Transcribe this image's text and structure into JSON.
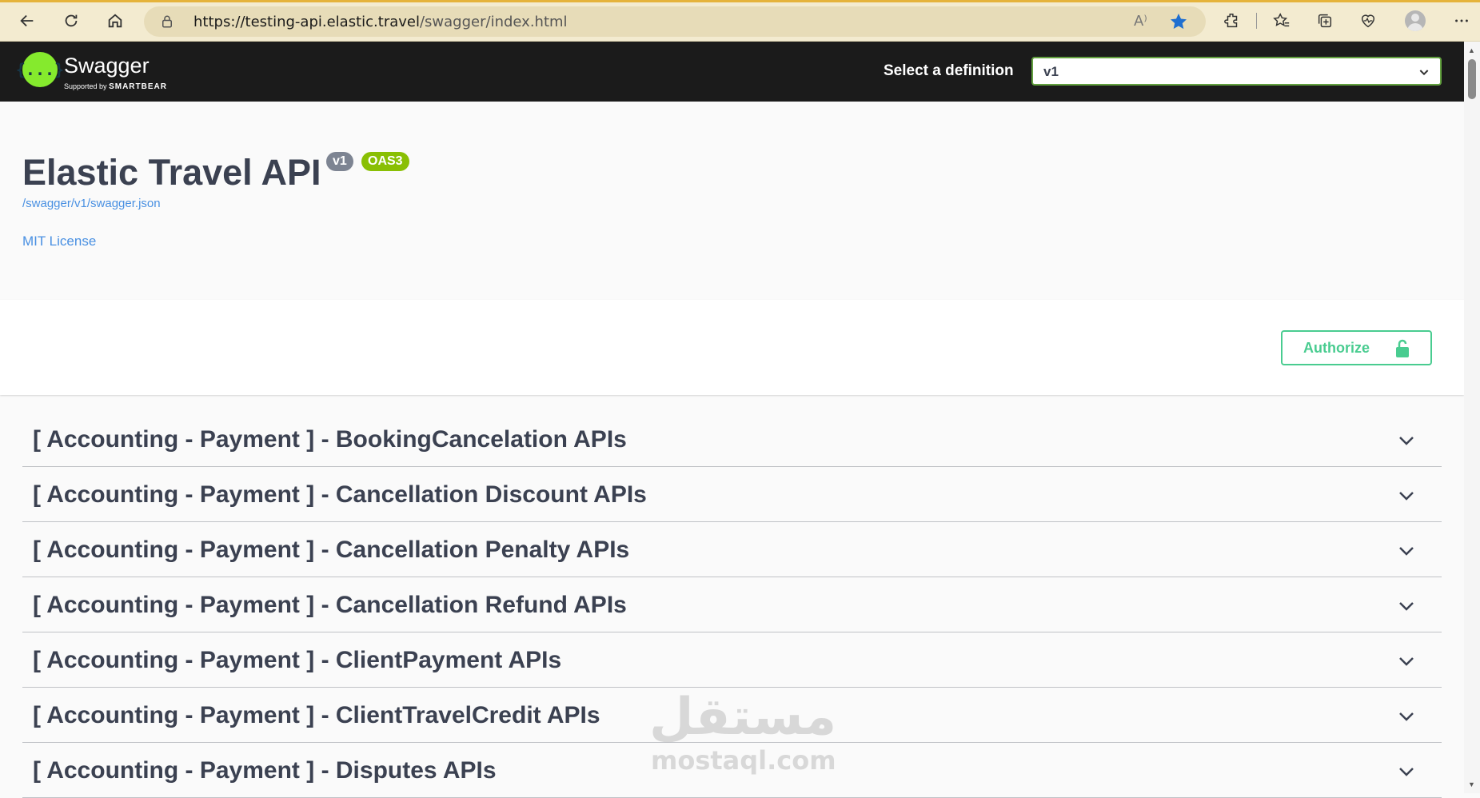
{
  "browser": {
    "url_host": "https://testing-api.elastic.travel",
    "url_path": "/swagger/index.html",
    "read_aloud": "A⁾"
  },
  "topbar": {
    "logo_text": "Swagger",
    "logo_symbol": "{...}",
    "logo_sub_prefix": "Supported by",
    "logo_sub_brand": "SMARTBEAR",
    "definition_label": "Select a definition",
    "definition_value": "v1"
  },
  "info": {
    "title": "Elastic Travel API",
    "version_badge": "v1",
    "oas_badge": "OAS3",
    "spec_link": "/swagger/v1/swagger.json",
    "license_link": "MIT License"
  },
  "scheme": {
    "authorize_label": "Authorize"
  },
  "tags": [
    {
      "title": "[ Accounting - Payment ] - BookingCancelation APIs"
    },
    {
      "title": "[ Accounting - Payment ] - Cancellation Discount APIs"
    },
    {
      "title": "[ Accounting - Payment ] - Cancellation Penalty APIs"
    },
    {
      "title": "[ Accounting - Payment ] - Cancellation Refund APIs"
    },
    {
      "title": "[ Accounting - Payment ] - ClientPayment APIs"
    },
    {
      "title": "[ Accounting - Payment ] - ClientTravelCredit APIs"
    },
    {
      "title": "[ Accounting - Payment ] - Disputes APIs"
    }
  ],
  "watermark": {
    "arabic": "مستقل",
    "latin": "mostaql.com"
  },
  "colors": {
    "topbar_bg": "#1b1b1b",
    "swagger_green": "#85ea2d",
    "authorize_green": "#49cc90",
    "oas_badge": "#89bf04",
    "link_blue": "#4990e2"
  },
  "icons": [
    "back-icon",
    "refresh-icon",
    "home-icon",
    "lock-icon",
    "star-icon",
    "extensions-icon",
    "favorites-icon",
    "collections-icon",
    "health-icon",
    "profile-icon",
    "more-icon",
    "chevron-down-icon",
    "unlock-icon"
  ]
}
